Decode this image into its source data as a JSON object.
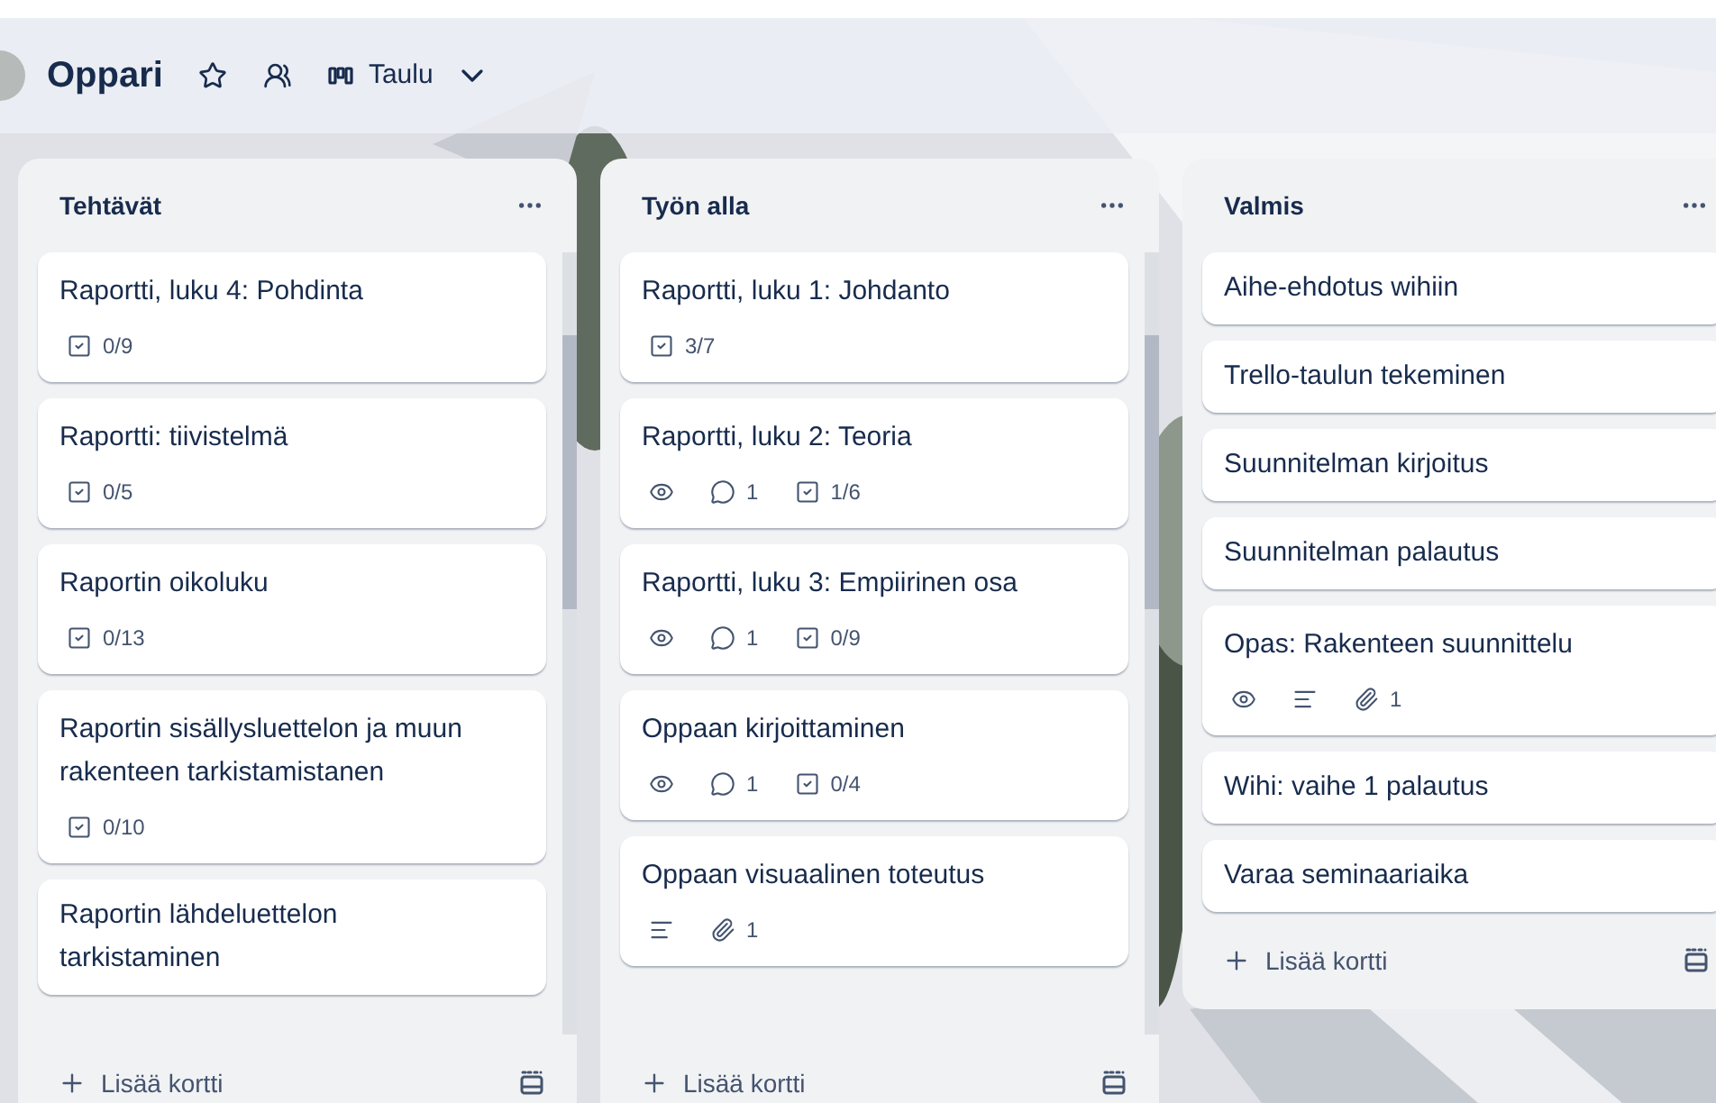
{
  "board": {
    "title": "Oppari",
    "view": "Taulu"
  },
  "lists": [
    {
      "title": "Tehtävät",
      "scroll": true,
      "add_label": "Lisää kortti",
      "cards": [
        {
          "title": "Raportti, luku 4: Pohdinta",
          "badges": [
            {
              "kind": "checklist",
              "text": "0/9"
            }
          ]
        },
        {
          "title": "Raportti: tiivistelmä",
          "badges": [
            {
              "kind": "checklist",
              "text": "0/5"
            }
          ]
        },
        {
          "title": "Raportin oikoluku",
          "badges": [
            {
              "kind": "checklist",
              "text": "0/13"
            }
          ]
        },
        {
          "title": "Raportin sisällysluettelon ja muun rakenteen tarkistamistanen",
          "badges": [
            {
              "kind": "checklist",
              "text": "0/10"
            }
          ]
        },
        {
          "title": "Raportin lähdeluettelon tarkistaminen"
        }
      ]
    },
    {
      "title": "Työn alla",
      "scroll": true,
      "add_label": "Lisää kortti",
      "cards": [
        {
          "title": "Raportti, luku 1: Johdanto",
          "badges": [
            {
              "kind": "checklist",
              "text": "3/7"
            }
          ]
        },
        {
          "title": "Raportti, luku 2: Teoria",
          "badges": [
            {
              "kind": "watch"
            },
            {
              "kind": "comments",
              "text": "1"
            },
            {
              "kind": "checklist",
              "text": "1/6"
            }
          ]
        },
        {
          "title": "Raportti, luku 3: Empiirinen osa",
          "badges": [
            {
              "kind": "watch"
            },
            {
              "kind": "comments",
              "text": "1"
            },
            {
              "kind": "checklist",
              "text": "0/9"
            }
          ]
        },
        {
          "title": "Oppaan kirjoittaminen",
          "badges": [
            {
              "kind": "watch"
            },
            {
              "kind": "comments",
              "text": "1"
            },
            {
              "kind": "checklist",
              "text": "0/4"
            }
          ]
        },
        {
          "title": "Oppaan visuaalinen toteutus",
          "badges": [
            {
              "kind": "description"
            },
            {
              "kind": "attachments",
              "text": "1"
            }
          ]
        }
      ]
    },
    {
      "title": "Valmis",
      "scroll": false,
      "add_label": "Lisää kortti",
      "cards": [
        {
          "title": "Aihe-ehdotus wihiin"
        },
        {
          "title": "Trello-taulun tekeminen"
        },
        {
          "title": "Suunnitelman kirjoitus"
        },
        {
          "title": "Suunnitelman palautus"
        },
        {
          "title": "Opas: Rakenteen suunnittelu",
          "badges": [
            {
              "kind": "watch"
            },
            {
              "kind": "description"
            },
            {
              "kind": "attachments",
              "text": "1"
            }
          ]
        },
        {
          "title": "Wihi: vaihe 1 palautus"
        },
        {
          "title": "Varaa seminaariaika"
        }
      ]
    }
  ]
}
